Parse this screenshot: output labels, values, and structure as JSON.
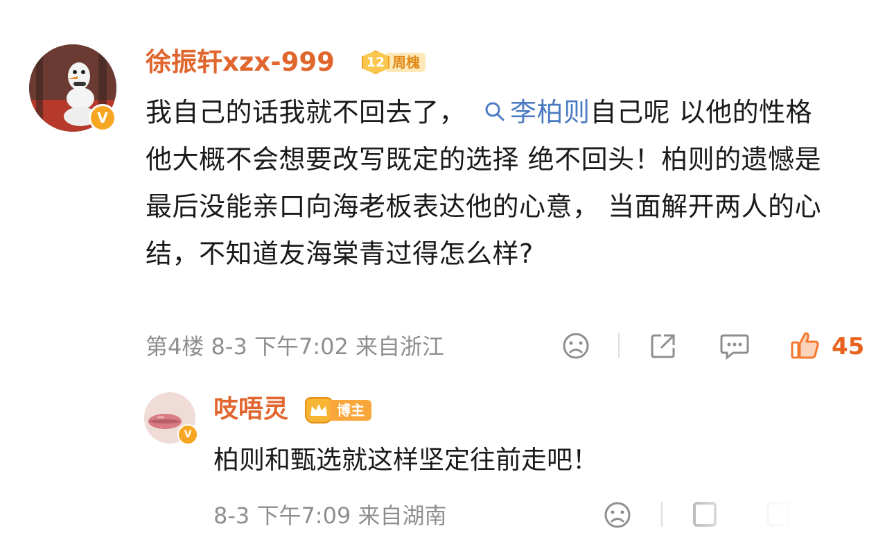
{
  "comment": {
    "username": "徐振轩xzx-999",
    "level": "12",
    "level_tag": "周槐",
    "text_before": "我自己的话我就不回去了，",
    "mention_icon": "search-icon",
    "mention": "李柏则",
    "text_after": "自己呢 以他的性格 他大概不会想要改写既定的选择 绝不回头！柏则的遗憾是最后没能亲口向海老板表达他的心意， 当面解开两人的心结，不知道友海棠青过得怎么样?",
    "meta": "第4楼 8-3 下午7:02 来自浙江",
    "like_count": "45",
    "verified_badge": "V",
    "like_icon": "thumbs-up-icon"
  },
  "reply": {
    "username": "吱唔灵",
    "badge_tag": "博主",
    "text": "柏则和甄选就这样坚定往前走吧！",
    "meta": "8-3 下午7:09 来自湖南",
    "verified_badge": "V"
  },
  "colors": {
    "username": "#e0662e",
    "mention": "#4b7bc1",
    "meta": "#8e8e8e",
    "like": "#e8631f",
    "badge": "#f6a623"
  }
}
